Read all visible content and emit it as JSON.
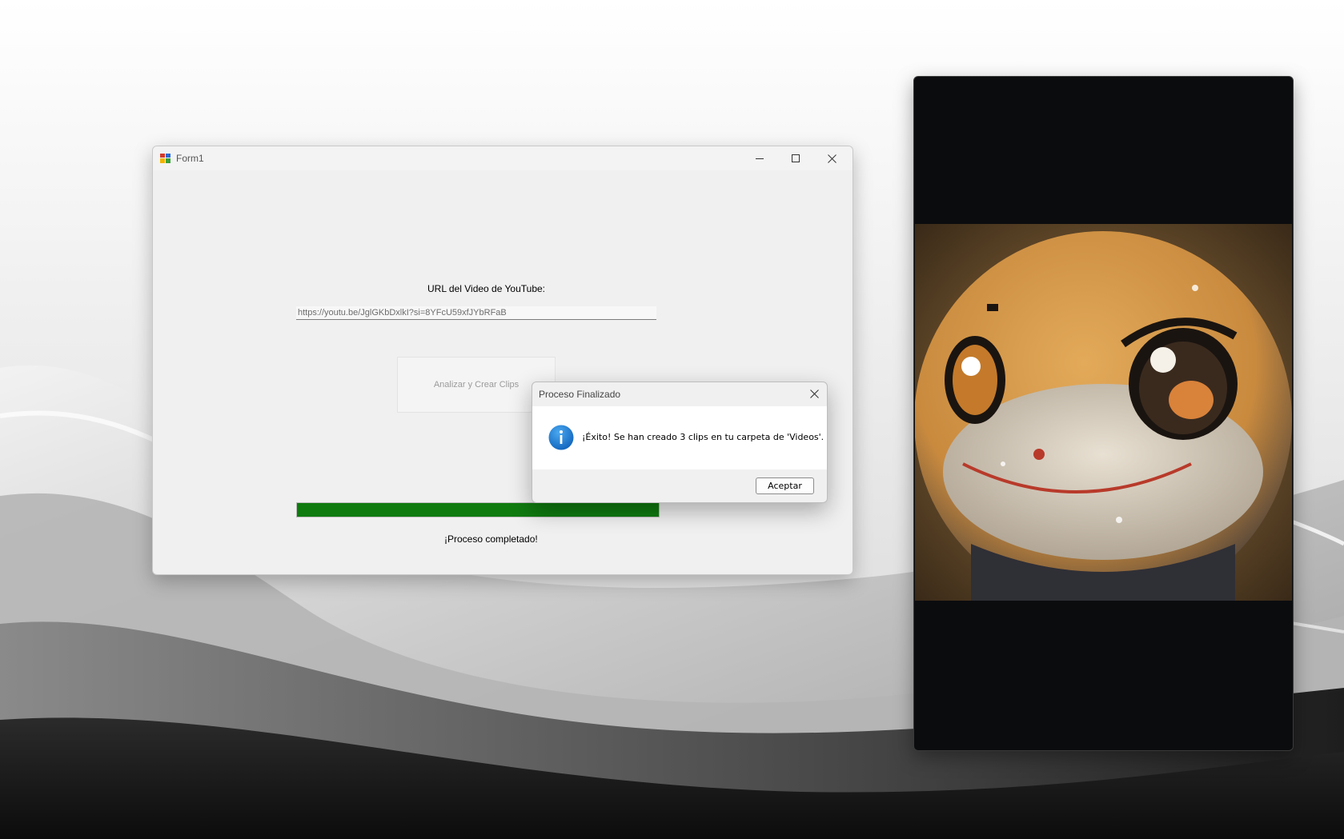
{
  "form": {
    "title": "Form1",
    "url_label": "URL del Video de YouTube:",
    "url_value": "https://youtu.be/JglGKbDxlkI?si=8YFcU59xfJYbRFaB",
    "analyze_button_label": "Analizar y Crear Clips",
    "progress_percent": 100,
    "status_text": "¡Proceso completado!"
  },
  "message_box": {
    "title": "Proceso Finalizado",
    "message": "¡Éxito! Se han creado 3 clips en tu carpeta de 'Videos'.",
    "accept_label": "Aceptar",
    "icon": "info-icon"
  },
  "viewer": {
    "content": "photo of a cartoon character inside a glass sphere"
  },
  "colors": {
    "progress_fill": "#0f7b0f",
    "info_icon": "#1976d2"
  }
}
